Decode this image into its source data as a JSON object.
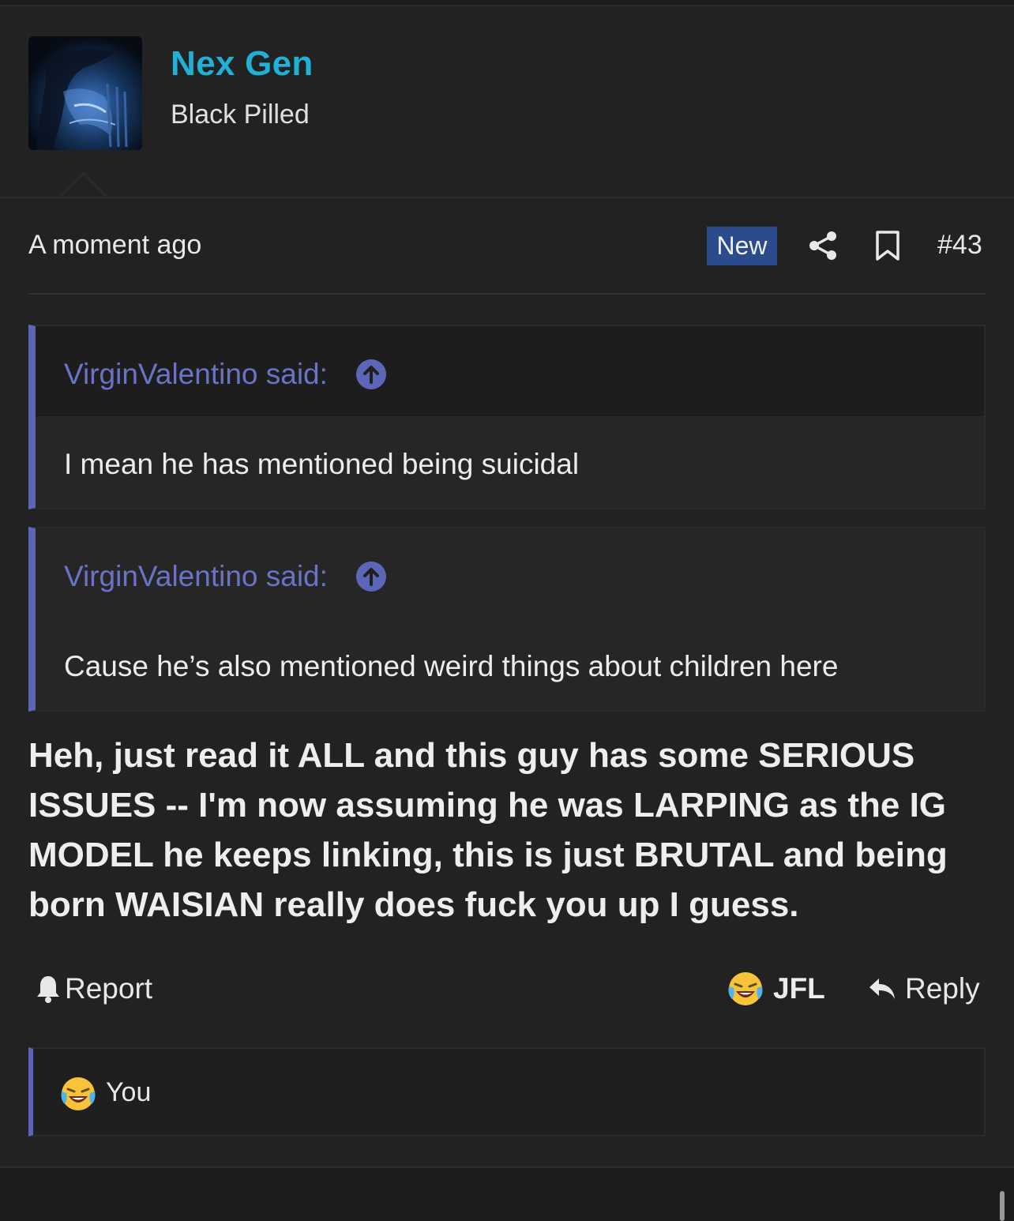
{
  "user": {
    "name": "Nex Gen",
    "title": "Black Pilled"
  },
  "post": {
    "time": "A moment ago",
    "badge": "New",
    "number": "#43",
    "quotes": [
      {
        "attribution": "VirginValentino said:",
        "text": "I mean he has mentioned being suicidal"
      },
      {
        "attribution": "VirginValentino said:",
        "text": "Cause he’s also mentioned weird things about children here"
      }
    ],
    "body": "Heh, just read it ALL and this guy has some SERIOUS ISSUES -- I'm now assuming he was LARPING as the IG MODEL he keeps linking, this is just BRUTAL and being born WAISIAN really does fuck you up I guess."
  },
  "actions": {
    "report_label": "Report",
    "reaction_label": "JFL",
    "reply_label": "Reply"
  },
  "reactions": {
    "you_label": "You"
  },
  "icons": {
    "reaction_emoji": "laughing-crying-emoji",
    "accent_color": "#5c65b8",
    "username_color": "#1fb2d6",
    "badge_color": "#2b4b8c"
  }
}
